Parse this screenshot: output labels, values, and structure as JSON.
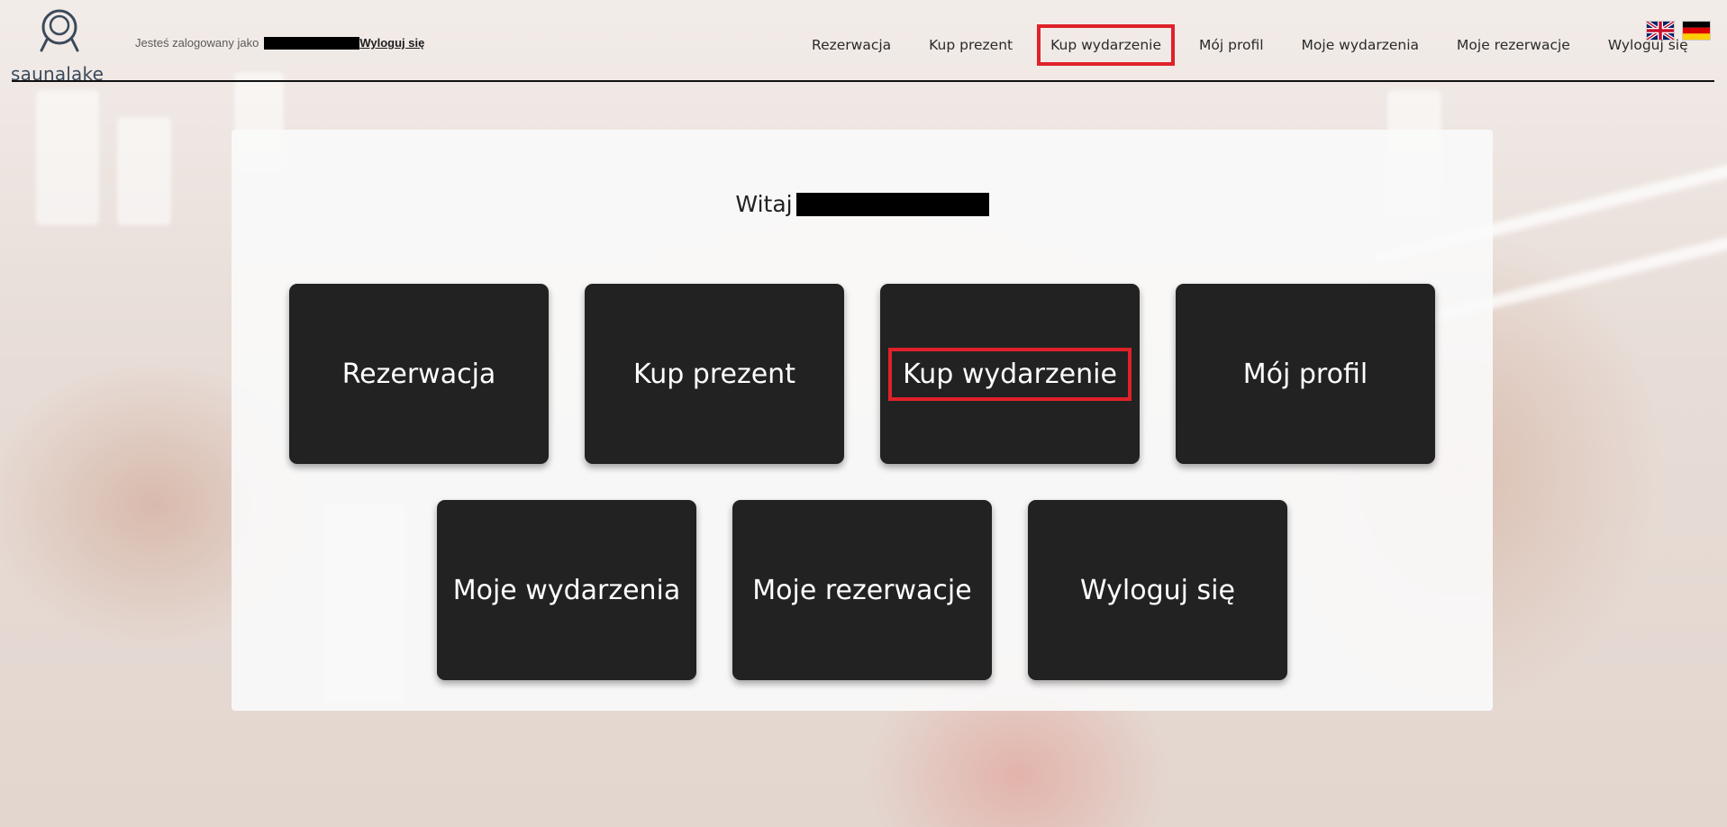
{
  "brand": {
    "name": "saunalake"
  },
  "header": {
    "login_prefix": "Jesteś zalogowany jako",
    "logout_link": "Wyloguj się"
  },
  "nav": {
    "items": [
      {
        "label": "Rezerwacja"
      },
      {
        "label": "Kup prezent"
      },
      {
        "label": "Kup wydarzenie",
        "highlighted": true
      },
      {
        "label": "Mój profil"
      },
      {
        "label": "Moje wydarzenia"
      },
      {
        "label": "Moje rezerwacje"
      },
      {
        "label": "Wyloguj się"
      }
    ],
    "languages": [
      {
        "code": "en",
        "icon": "uk-flag-icon"
      },
      {
        "code": "de",
        "icon": "de-flag-icon"
      }
    ]
  },
  "main": {
    "welcome": "Witaj",
    "tiles": [
      {
        "label": "Rezerwacja"
      },
      {
        "label": "Kup prezent"
      },
      {
        "label": "Kup wydarzenie",
        "highlighted": true
      },
      {
        "label": "Mój profil"
      },
      {
        "label": "Moje wydarzenia"
      },
      {
        "label": "Moje rezerwacje"
      },
      {
        "label": "Wyloguj się"
      }
    ]
  },
  "colors": {
    "tile_bg": "#222222",
    "highlight": "#e0212a",
    "brand_text": "#3b4a5a"
  }
}
